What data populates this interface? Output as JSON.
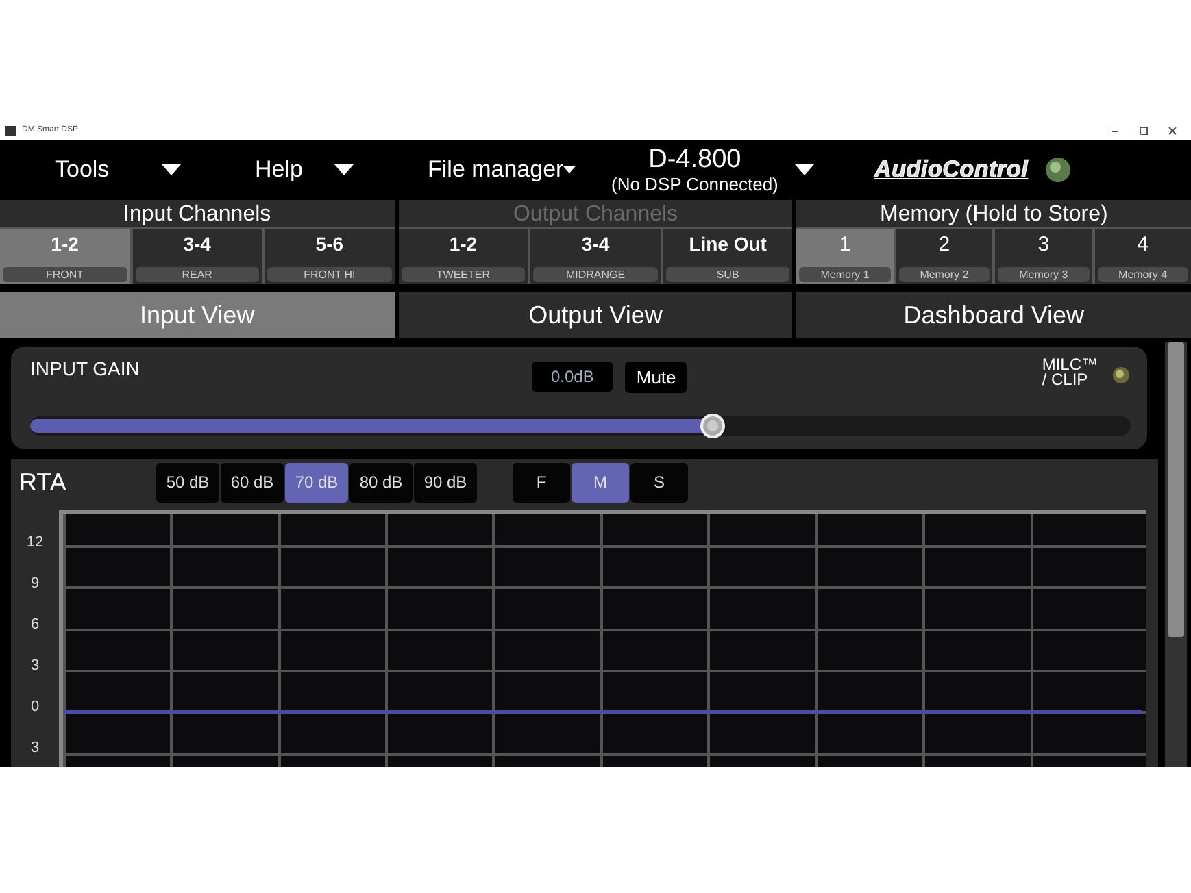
{
  "window": {
    "title": "DM Smart DSP"
  },
  "menus": [
    {
      "label": "Tools"
    },
    {
      "label": "Help"
    },
    {
      "label": "File manager"
    }
  ],
  "device": {
    "name": "D-4.800",
    "status": "(No DSP Connected)"
  },
  "logo": {
    "text": "AudioControl"
  },
  "channel_groups": [
    {
      "title": "Input Channels",
      "disabled": false,
      "kind": "channels",
      "items": [
        {
          "label": "1-2",
          "sublabel": "FRONT",
          "selected": true
        },
        {
          "label": "3-4",
          "sublabel": "REAR",
          "selected": false
        },
        {
          "label": "5-6",
          "sublabel": "FRONT HI",
          "selected": false
        }
      ]
    },
    {
      "title": "Output Channels",
      "disabled": true,
      "kind": "channels",
      "items": [
        {
          "label": "1-2",
          "sublabel": "TWEETER",
          "selected": false
        },
        {
          "label": "3-4",
          "sublabel": "MIDRANGE",
          "selected": false
        },
        {
          "label": "Line Out",
          "sublabel": "SUB",
          "selected": false
        }
      ]
    },
    {
      "title": "Memory (Hold to Store)",
      "disabled": false,
      "kind": "memory",
      "items": [
        {
          "label": "1",
          "sublabel": "Memory 1",
          "selected": true
        },
        {
          "label": "2",
          "sublabel": "Memory 2",
          "selected": false
        },
        {
          "label": "3",
          "sublabel": "Memory 3",
          "selected": false
        },
        {
          "label": "4",
          "sublabel": "Memory 4",
          "selected": false
        }
      ]
    }
  ],
  "view_tabs": [
    {
      "label": "Input View",
      "selected": true
    },
    {
      "label": "Output View",
      "selected": false
    },
    {
      "label": "Dashboard View",
      "selected": false
    }
  ],
  "input_gain": {
    "label": "INPUT GAIN",
    "value": "0.0dB",
    "mute": "Mute",
    "level": 0.62,
    "clip_label": [
      "MILC™",
      "/ CLIP"
    ]
  },
  "rta": {
    "title": "RTA",
    "ranges": [
      {
        "label": "50 dB",
        "selected": false
      },
      {
        "label": "60 dB",
        "selected": false
      },
      {
        "label": "70 dB",
        "selected": true
      },
      {
        "label": "80 dB",
        "selected": false
      },
      {
        "label": "90 dB",
        "selected": false
      }
    ],
    "modes": [
      {
        "label": "F",
        "selected": false
      },
      {
        "label": "M",
        "selected": true
      },
      {
        "label": "S",
        "selected": false
      }
    ],
    "y_ticks": [
      "12",
      "9",
      "6",
      "3",
      "0",
      "3"
    ]
  }
}
